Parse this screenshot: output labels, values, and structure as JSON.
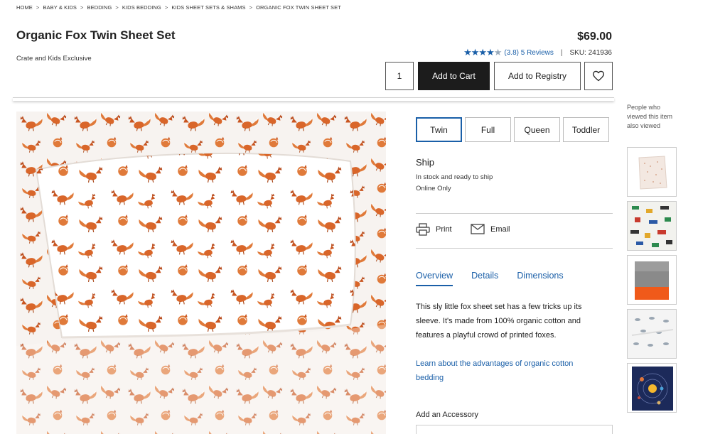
{
  "breadcrumb": [
    "Home",
    "Baby & Kids",
    "Bedding",
    "Kids Bedding",
    "Kids Sheet Sets & Shams",
    "Organic Fox Twin Sheet Set"
  ],
  "breadcrumb_separator": ">",
  "product": {
    "title": "Organic Fox Twin Sheet Set",
    "subtitle": "Crate and Kids Exclusive",
    "price": "$69.00",
    "rating_value": 3.8,
    "rating_text": "(3.8)",
    "reviews_text": "5 Reviews",
    "divider": "|",
    "sku": "SKU: 241936"
  },
  "purchase": {
    "quantity": "1",
    "add_to_cart": "Add to Cart",
    "add_to_registry": "Add to Registry"
  },
  "sizes": [
    {
      "label": "Twin",
      "selected": true
    },
    {
      "label": "Full",
      "selected": false
    },
    {
      "label": "Queen",
      "selected": false
    },
    {
      "label": "Toddler",
      "selected": false
    }
  ],
  "shipping": {
    "title": "Ship",
    "line1": "In stock and ready to ship",
    "line2": "Online Only"
  },
  "actions": {
    "print": "Print",
    "email": "Email"
  },
  "tabs": [
    {
      "label": "Overview",
      "active": true
    },
    {
      "label": "Details",
      "active": false
    },
    {
      "label": "Dimensions",
      "active": false
    }
  ],
  "overview": {
    "description": "This sly little fox sheet set has a few tricks up its sleeve. It's made from 100% organic cotton and features a playful crowd of printed foxes.",
    "learn_link": "Learn about the advantages of organic cotton bedding"
  },
  "accessory": {
    "label": "Add an Accessory"
  },
  "sidebar": {
    "label": "People who viewed this item also viewed"
  },
  "colors": {
    "link_blue": "#1a5fa8",
    "button_dark": "#1c1c1c",
    "fox_orange": "#d9662a"
  }
}
